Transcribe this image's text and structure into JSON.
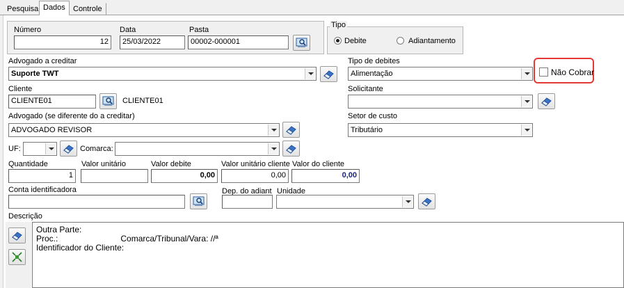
{
  "tabs": [
    {
      "label": "Pesquisa",
      "active": false
    },
    {
      "label": "Dados",
      "active": true
    },
    {
      "label": "Controle",
      "active": false
    }
  ],
  "numero": {
    "label": "Número",
    "value": "12"
  },
  "data": {
    "label": "Data",
    "value": "25/03/2022"
  },
  "pasta": {
    "label": "Pasta",
    "value": "00002-000001"
  },
  "tipo": {
    "label": "Tipo",
    "options": [
      {
        "label": "Debite",
        "selected": true
      },
      {
        "label": "Adiantamento",
        "selected": false
      }
    ]
  },
  "advogado_creditar": {
    "label": "Advogado a creditar",
    "value": "Suporte TWT"
  },
  "tipo_debites": {
    "label": "Tipo de debites",
    "value": "Alimentação"
  },
  "nao_cobrar": {
    "label": "Não Cobrar",
    "checked": false
  },
  "cliente": {
    "label": "Cliente",
    "code": "CLIENTE01",
    "name": "CLIENTE01"
  },
  "solicitante": {
    "label": "Solicitante",
    "value": ""
  },
  "advogado": {
    "label": "Advogado  (se diferente do a creditar)",
    "value": "ADVOGADO REVISOR"
  },
  "setor_custo": {
    "label": "Setor de custo",
    "value": "Tributário"
  },
  "uf": {
    "label": "UF:",
    "value": ""
  },
  "comarca": {
    "label": "Comarca:",
    "value": ""
  },
  "quantidade": {
    "label": "Quantidade",
    "value": "1"
  },
  "valor_unitario": {
    "label": "Valor unitário",
    "value": ""
  },
  "valor_debite": {
    "label": "Valor debite",
    "value": "0,00"
  },
  "valor_unitario_cliente": {
    "label": "Valor unitário cliente",
    "value": "0,00"
  },
  "valor_cliente": {
    "label": "Valor do cliente",
    "value": "0,00"
  },
  "conta_identificadora": {
    "label": "Conta identificadora",
    "value": ""
  },
  "dep_adiant": {
    "label": "Dep. do adiant",
    "value": ""
  },
  "unidade": {
    "label": "Unidade",
    "value": ""
  },
  "descricao": {
    "label": "Descrição",
    "lines": [
      "Outra Parte:",
      "Proc.:                           Comarca/Tribunal/Vara: //ª",
      "Identificador do Cliente:"
    ]
  },
  "icons": [
    "search-icon",
    "eraser-icon",
    "expand-icon",
    "chevron-down-icon"
  ]
}
